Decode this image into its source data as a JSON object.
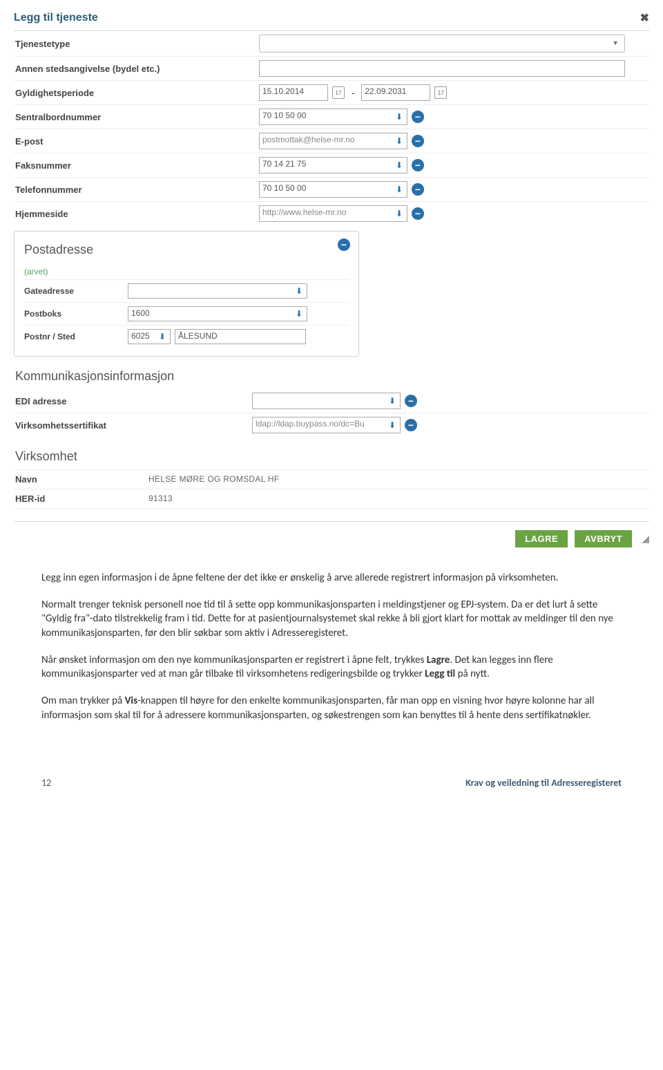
{
  "dialog": {
    "title": "Legg til tjeneste",
    "fields": {
      "tjenestetype": "Tjenestetype",
      "annen": "Annen stedsangivelse (bydel etc.)",
      "gyldig": "Gyldighetsperiode",
      "sentral": "Sentralbordnummer",
      "epost": "E-post",
      "faks": "Faksnummer",
      "tlf": "Telefonnummer",
      "hjem": "Hjemmeside"
    },
    "values": {
      "dateFrom": "15.10.2014",
      "dateTo": "22.09.2031",
      "dash": "-",
      "sentral": "70 10 50 00",
      "epost": "postmottak@helse-mr.no",
      "faks": "70 14 21 75",
      "tlf": "70 10 50 00",
      "hjem": "http://www.helse-mr.no"
    },
    "post": {
      "title": "Postadresse",
      "arvet": "(arvet)",
      "gate": "Gateadresse",
      "postboks": "Postboks",
      "postnrsted": "Postnr / Sted",
      "postboksVal": "1600",
      "postnrVal": "6025",
      "stedVal": "ÅLESUND"
    },
    "komm": {
      "title": "Kommunikasjonsinformasjon",
      "edi": "EDI adresse",
      "sert": "Virksomhetssertifikat",
      "ediVal": "",
      "sertVal": "ldap://ldap.buypass.no/dc=Bu"
    },
    "virk": {
      "title": "Virksomhet",
      "navnLbl": "Navn",
      "herLbl": "HER-id",
      "navn": "HELSE MØRE OG ROMSDAL HF",
      "her": "91313"
    },
    "buttons": {
      "lagre": "LAGRE",
      "avbryt": "AVBRYT"
    }
  },
  "doc": {
    "p1": "Legg inn egen informasjon i de åpne feltene der det ikke er ønskelig å arve allerede registrert informasjon på virksomheten.",
    "p2a": "Normalt trenger teknisk personell noe tid til å sette opp kommunikasjonsparten i meldingstjener og EPJ-system. Da er det lurt å sette \"Gyldig fra\"-dato tilstrekkelig fram i tid. Dette for at pasientjournalsystemet skal rekke å bli gjort klart for mottak av meldinger til den nye kommunikasjonsparten, før den blir søkbar som aktiv i Adresseregisteret.",
    "p3a": "Når ønsket informasjon om den nye kommunikasjonsparten er registrert i åpne felt, trykkes ",
    "p3bold1": "Lagre",
    "p3b": ". Det kan legges inn flere kommunikasjonsparter ved at man går tilbake til virksomhetens redigeringsbilde og trykker ",
    "p3bold2": "Legg til",
    "p3c": " på nytt.",
    "p4a": "Om man trykker på ",
    "p4bold": "Vis",
    "p4b": "-knappen til høyre for den enkelte kommunikasjonsparten, får man opp en visning hvor høyre kolonne har all informasjon som skal til for å adressere kommunikasjonsparten, og søkestrengen som kan benyttes til å hente dens sertifikatnøkler."
  },
  "footer": {
    "page": "12",
    "title": "Krav og veiledning til Adresseregisteret"
  }
}
